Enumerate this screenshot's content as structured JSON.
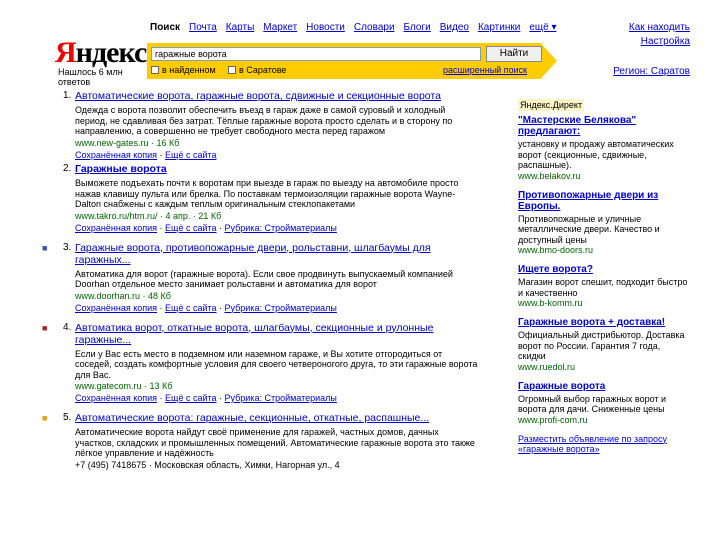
{
  "header": {
    "logo_y": "Я",
    "logo_rest": "ндекс",
    "found_text": "Нашлось 6 млн ответов",
    "tabs": [
      "Поиск",
      "Почта",
      "Карты",
      "Маркет",
      "Новости",
      "Словари",
      "Блоги",
      "Видео",
      "Картинки",
      "ещё ▾"
    ],
    "right_top": "Как находить",
    "right_settings": "Настройка",
    "region": "Регион: Саратов"
  },
  "search": {
    "query": "гаражные ворота",
    "button": "Найти",
    "opt1": "в найденном",
    "opt2": "в Саратове",
    "advanced": "расширенный поиск"
  },
  "results": [
    {
      "num": "1.",
      "title": "Автоматические ворота, гаражные ворота, сдвижные и секционные ворота",
      "snippet": "Одежда с ворота позволит обеспечить въезд в гараж даже в самой суровый и холодный период, не сдавливая без затрат. Тёплые гаражные ворота просто сделать и в сторону по направлению, а совершенно не требует свободного места перед гаражом",
      "url": "www.new-gates.ru · 16 Кб",
      "meta": [
        "Сохранённая копия",
        "Ещё с сайта"
      ],
      "favicon": "",
      "favicon_color": ""
    },
    {
      "num": "2.",
      "title": "Гаражные ворота",
      "snippet": "Выможете подъехать почти к воротам при выезде в гараж по выезду на автомобиле просто нажав клавишу пульта или брелка. По поставкам термоизоляции гаражные ворота Wayne-Dalton снабжены с каждым теплым оригинальным стеклопакетами",
      "url": "www.takro.ru/htm.ru/ · 4 апр. · 21 Кб",
      "meta": [
        "Сохранённая копия",
        "Ещё с сайта",
        "Рубрика: Стройматериалы"
      ],
      "favicon": "",
      "favicon_color": ""
    },
    {
      "num": "3.",
      "title": "Гаражные ворота, противопожарные двери, рольставни, шлагбаумы для гаражных...",
      "snippet": "Автоматика для ворот (гаражные ворота). Если свое продвинуть выпускаемый компанией Doorhan отдельное место занимает рольставни и автоматика для ворот",
      "url": "www.doorhan.ru · 48 Кб",
      "meta": [
        "Сохранённая копия",
        "Ещё с сайта",
        "Рубрика: Стройматериалы"
      ],
      "favicon": "■",
      "favicon_color": "#3355aa"
    },
    {
      "num": "4.",
      "title": "Автоматика ворот, откатные ворота, шлагбаумы, секционные и рулонные гаражные...",
      "snippet": "Если у Вас есть место в подземном или наземном гараже, и Вы хотите отгородиться от соседей, создать комфортные условия для своего четвероногого друга, то эти гаражные ворота для Вас.",
      "url": "www.gatecom.ru · 13 Кб",
      "meta": [
        "Сохранённая копия",
        "Ещё с сайта",
        "Рубрика: Стройматериалы"
      ],
      "favicon": "■",
      "favicon_color": "#aa2222"
    },
    {
      "num": "5.",
      "title": "Автоматические ворота: гаражные, секционные, откатные, распашные...",
      "snippet": "Автоматические ворота найдут своё применение для гаражей, частных домов, дачных участков, складских и промышленных помещений. Автоматические гаражные ворота это также лёгкое управление и надёжность",
      "url": "+7 (495) 7418675 · Московская область, Химки, Нагорная ул., 4",
      "meta": [],
      "favicon": "■",
      "favicon_color": "#e8a000"
    }
  ],
  "ads": {
    "header": "Яндекс.Директ",
    "items": [
      {
        "title": "\"Мастерские Белякова\" предлагают:",
        "desc": "установку и продажу автоматических ворот (секционные, сдвижные, распашные).",
        "url": "www.belakov.ru"
      },
      {
        "title": "Противопожарные двери из Европы.",
        "desc": "Противопожарные и уличные металлические двери. Качество и доступный цены",
        "url": "www.bmo-doors.ru"
      },
      {
        "title": "Ищете ворота?",
        "desc": "Магазин ворот спешит, подходит быстро и качественно",
        "url": "www.b-komm.ru"
      },
      {
        "title": "Гаражные ворота + доставка!",
        "desc": "Официальный дистрибьютор. Доставка ворот по России. Гарантия 7 года, скидки",
        "url": "www.ruedol.ru"
      },
      {
        "title": "Гаражные ворота",
        "desc": "Огромный выбор гаражных ворот и ворота для дачи. Сниженные цены",
        "url": "www.profi-com.ru"
      }
    ],
    "bottom": "Разместить объявление по запросу «гаражные ворота»"
  }
}
